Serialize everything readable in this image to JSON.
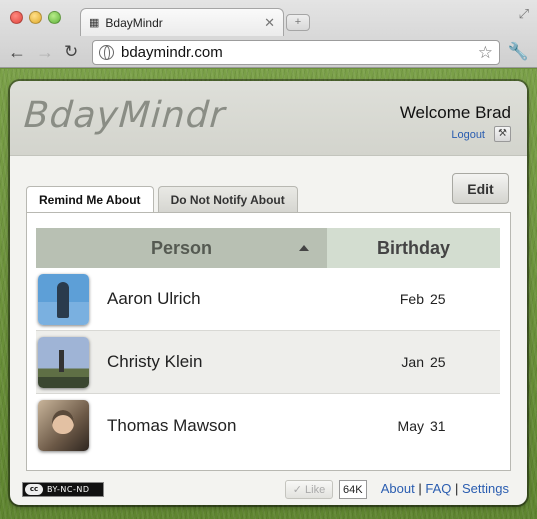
{
  "browser": {
    "tab_title": "BdayMindr",
    "url": "bdaymindr.com"
  },
  "header": {
    "logo": "BdayMindr",
    "welcome": "Welcome Brad",
    "logout_label": "Logout"
  },
  "tabs": [
    {
      "label": "Remind Me About",
      "active": true
    },
    {
      "label": "Do Not Notify About",
      "active": false
    }
  ],
  "edit_label": "Edit",
  "table": {
    "col_person": "Person",
    "col_birthday": "Birthday",
    "rows": [
      {
        "name": "Aaron Ulrich",
        "month": "Feb",
        "day": "25"
      },
      {
        "name": "Christy Klein",
        "month": "Jan",
        "day": "25"
      },
      {
        "name": "Thomas Mawson",
        "month": "May",
        "day": "31"
      }
    ]
  },
  "footer": {
    "license_logo": "cc",
    "license_text": "BY-NC-ND",
    "like_label": "Like",
    "like_count": "64K",
    "links": [
      "About",
      "FAQ",
      "Settings"
    ],
    "separator": "|"
  },
  "icons": {
    "tab_favicon": "calendar-icon",
    "sort": "sort-asc-icon",
    "tool": "wrench-icon"
  }
}
